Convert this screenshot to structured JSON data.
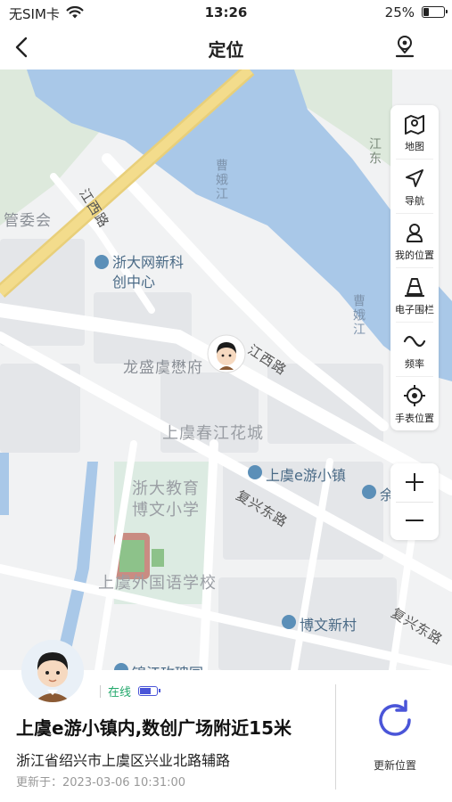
{
  "status_bar": {
    "carrier": "无SIM卡",
    "time": "13:26",
    "battery": "25%"
  },
  "nav": {
    "title": "定位"
  },
  "map": {
    "labels": {
      "guanweihui": "管委会",
      "jiangxi_road_upper": "江西路",
      "caoe_river_1": "曹娥江",
      "caoe_river_2": "曹娥江",
      "jiangdong": "江东",
      "longsheng": "龙盛虞懋府",
      "jiangxi_road": "江西路",
      "chunjiang": "上虞春江花城",
      "zheda_school": "浙大教育",
      "zheda_school_2": "博文小学",
      "fuxing_road_1": "复兴东路",
      "waiguoyu": "上虞外国语学校",
      "fuxing_road_2": "复兴东路"
    },
    "pois": {
      "zheda_line1": "浙大网新科",
      "zheda_line2": "创中心",
      "eyou": "上虞e游小镇",
      "yu": "余",
      "bowen": "博文新村",
      "jinjiang": "锦江玫瑰园"
    }
  },
  "toolbar": {
    "map": "地图",
    "navigate": "导航",
    "my_location": "我的位置",
    "fence": "电子围栏",
    "frequency": "频率",
    "watch_location": "手表位置"
  },
  "device": {
    "status": "在线",
    "battery_level": 0.7,
    "address_title": "上虞e游小镇内,数创广场附近15米",
    "address_detail": "浙江省绍兴市上虞区兴业北路辅路",
    "updated_at": "更新于：2023-03-06 10:31:00",
    "refresh_label": "更新位置"
  },
  "colors": {
    "accent": "#4a55d8",
    "online": "#22a86b",
    "water": "#a9c8e8",
    "highway": "#f3dc8c"
  }
}
